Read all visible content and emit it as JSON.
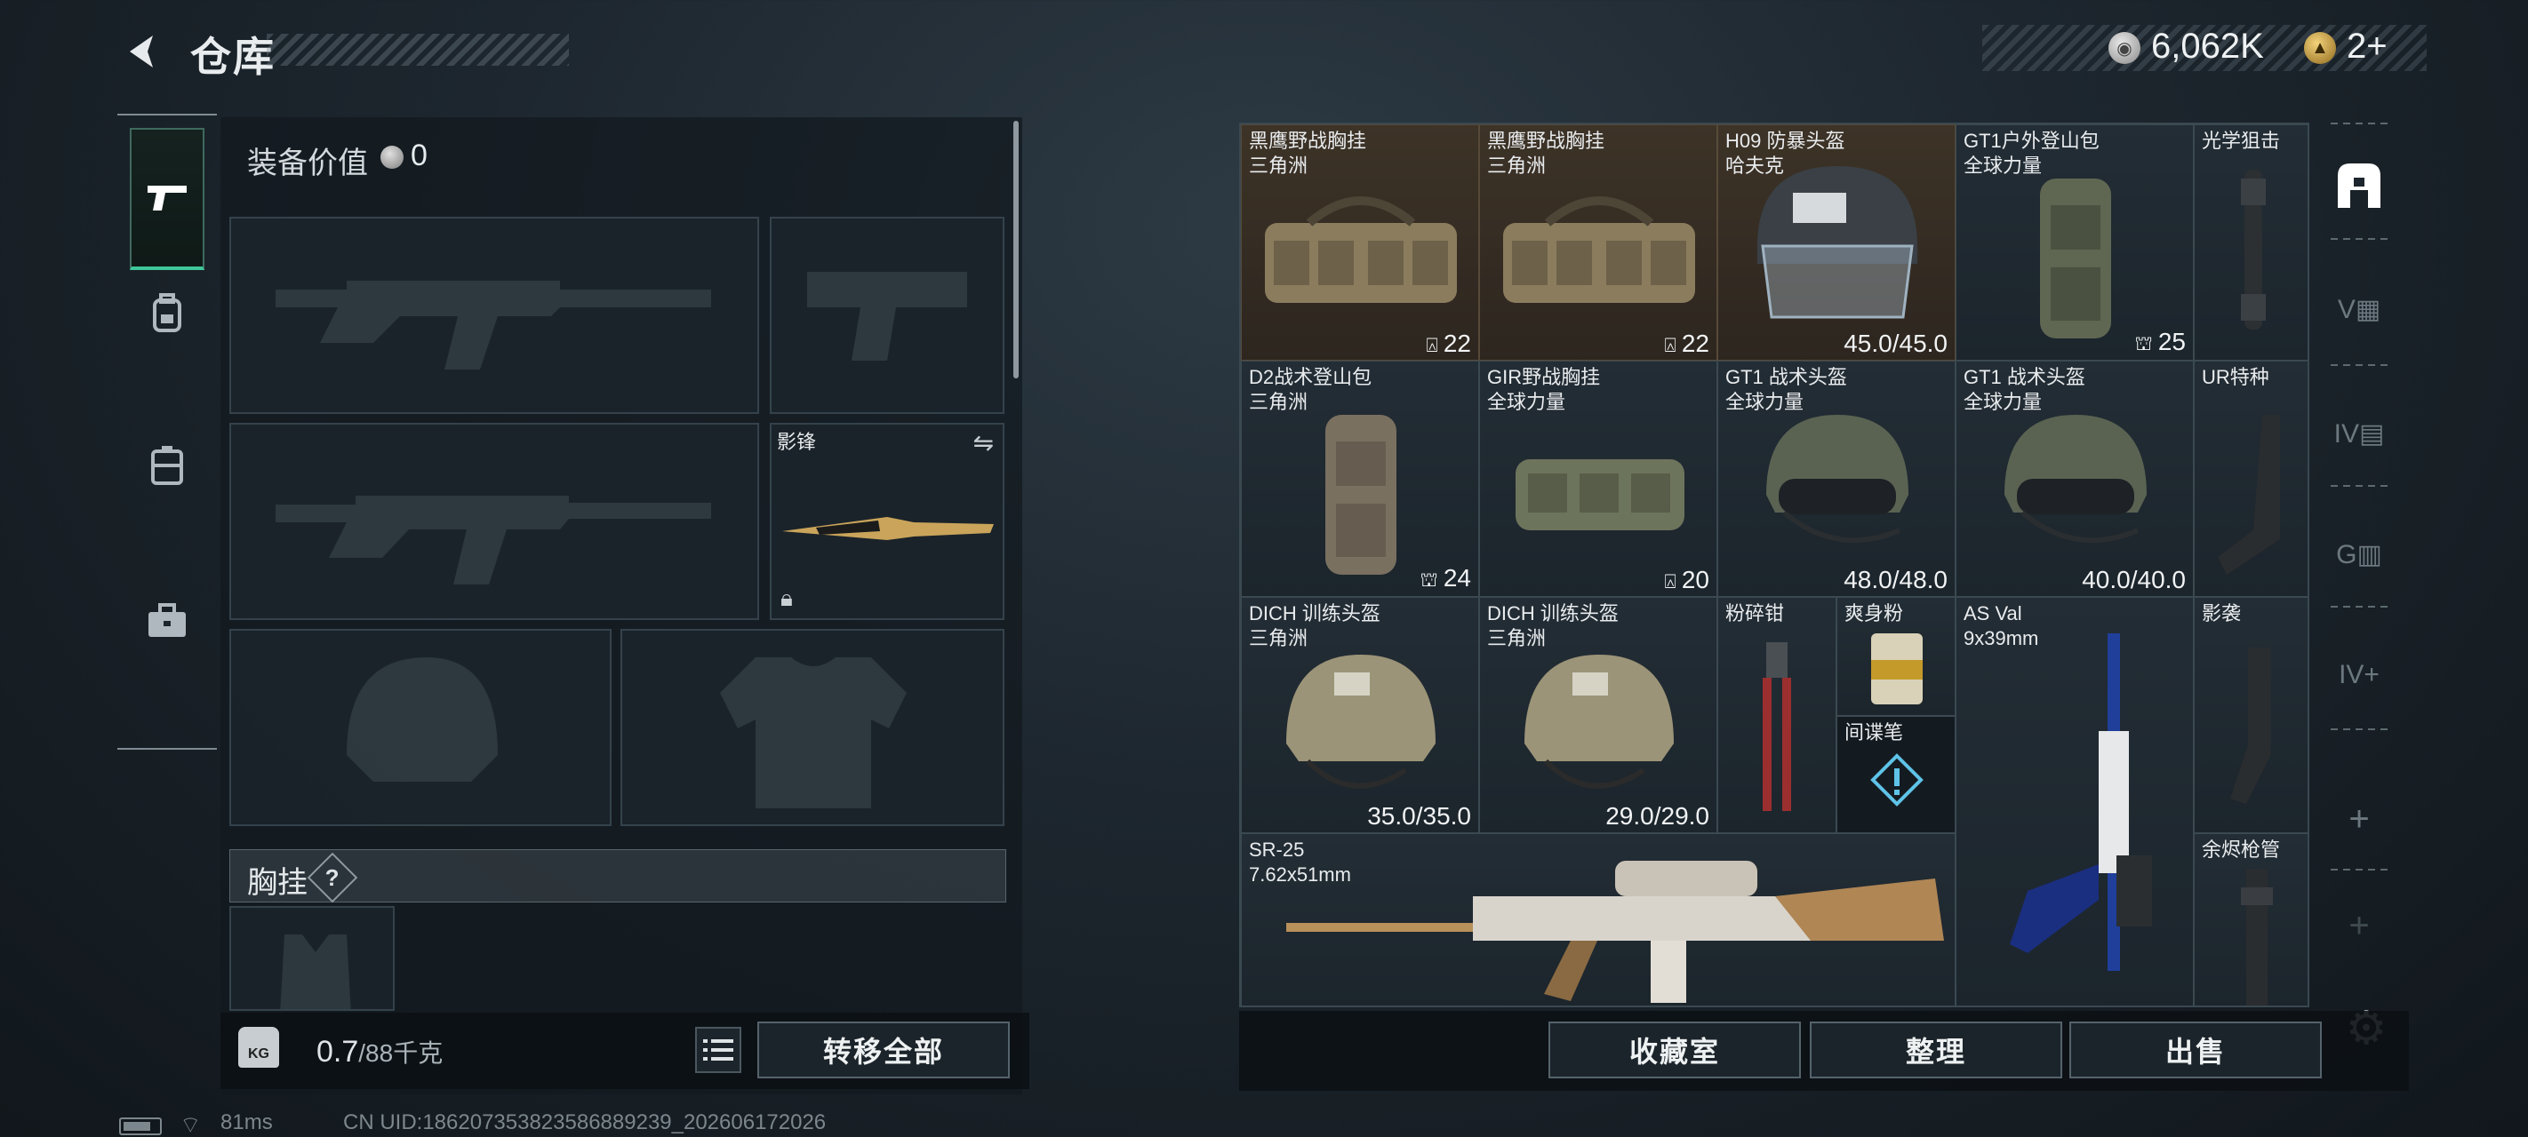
{
  "header": {
    "title": "仓库",
    "currency": {
      "silver_amount": "6,062K",
      "gold_amount": "2+"
    }
  },
  "left_rail": {
    "items": [
      {
        "name": "weapons",
        "icon": "pistol-icon",
        "active": true
      },
      {
        "name": "armor",
        "icon": "backpack-icon",
        "active": false
      },
      {
        "name": "rig",
        "icon": "vest-icon",
        "active": false
      },
      {
        "name": "toolbox",
        "icon": "toolbox-icon",
        "active": false
      }
    ]
  },
  "loadout": {
    "equip_value_label": "装备价值",
    "equip_value": "0",
    "melee_name": "影锋",
    "chest_label": "胸挂",
    "chest_help": "?",
    "weight_current": "0.7",
    "weight_cap": "/88千克",
    "kg_label": "KG",
    "transfer_all": "转移全部"
  },
  "status": {
    "ping": "81ms",
    "uid": "CN UID:18620735382358688923‌9_202606172026"
  },
  "warehouse": {
    "items": [
      {
        "name": "黑鹰野战胸挂",
        "sub": "三角洲",
        "stat": "22",
        "stat_icon": "vest-slot-icon"
      },
      {
        "name": "黑鹰野战胸挂",
        "sub": "三角洲",
        "stat": "22",
        "stat_icon": "vest-slot-icon"
      },
      {
        "name": "H09 防暴头盔",
        "sub": "哈夫克",
        "stat": "45.0/45.0"
      },
      {
        "name": "GT1户外登山包",
        "sub": "全球力量",
        "stat": "25",
        "stat_icon": "bag-slot-icon"
      },
      {
        "name": "光学狙击",
        "sub": ""
      },
      {
        "name": "D2战术登山包",
        "sub": "三角洲",
        "stat": "24",
        "stat_icon": "bag-slot-icon"
      },
      {
        "name": "GIR野战胸挂",
        "sub": "全球力量",
        "stat": "20",
        "stat_icon": "vest-slot-icon"
      },
      {
        "name": "GT1 战术头盔",
        "sub": "全球力量",
        "stat": "48.0/48.0"
      },
      {
        "name": "GT1 战术头盔",
        "sub": "全球力量",
        "stat": "40.0/40.0"
      },
      {
        "name": "UR特种",
        "sub": ""
      },
      {
        "name": "DICH 训练头盔",
        "sub": "三角洲",
        "stat": "35.0/35.0"
      },
      {
        "name": "DICH 训练头盔",
        "sub": "三角洲",
        "stat": "29.0/29.0"
      },
      {
        "name": "粉碎钳",
        "sub": ""
      },
      {
        "name": "爽身粉",
        "sub": ""
      },
      {
        "name": "间谍笔",
        "sub": ""
      },
      {
        "name": "AS Val",
        "sub": "9x39mm"
      },
      {
        "name": "影袭",
        "sub": ""
      },
      {
        "name": "SR-25",
        "sub": "7.62x51mm"
      },
      {
        "name": "余烬枪管",
        "sub": ""
      }
    ]
  },
  "right_rail": {
    "items": [
      "safe-icon",
      "tag-v-icon",
      "tag-iv-icon",
      "tag-g-icon",
      "tag-iv-plus-icon",
      "plus-icon",
      "plus-icon"
    ]
  },
  "actions": {
    "collection": "收藏室",
    "organize": "整理",
    "sell": "出售"
  }
}
